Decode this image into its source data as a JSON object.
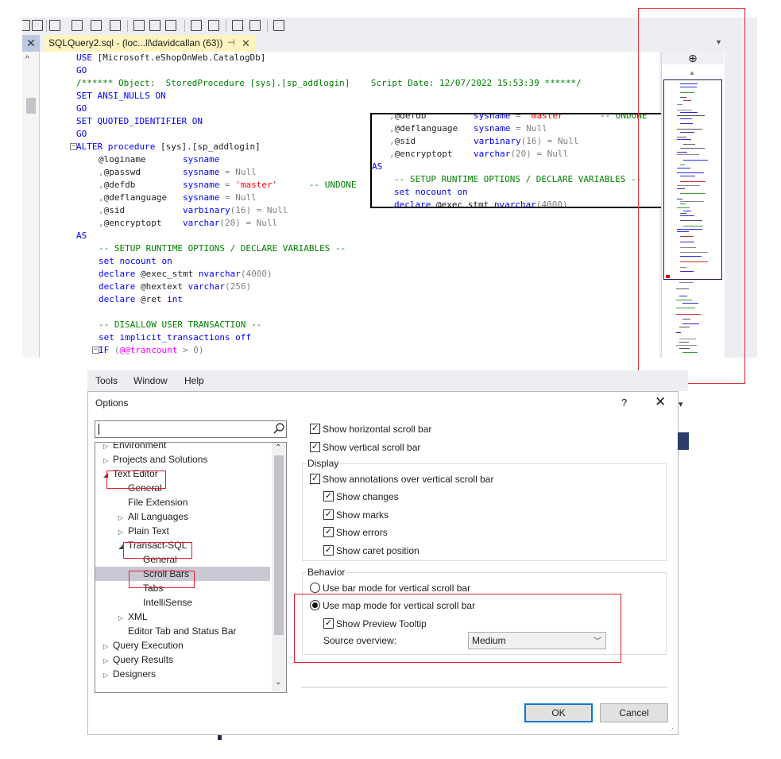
{
  "editor": {
    "tab_title": "SQLQuery2.sql - (loc...ll\\davidcallan (63))",
    "tab_pin": "⊣",
    "tab_close": "✕",
    "tab_dropdown": "▼",
    "left_close": "✕",
    "code_lines": [
      {
        "indent": 0,
        "parts": [
          [
            "kw",
            "USE "
          ],
          [
            "",
            "[Microsoft.eShopOnWeb.CatalogDb]"
          ]
        ]
      },
      {
        "indent": 0,
        "parts": [
          [
            "kw",
            "GO"
          ]
        ]
      },
      {
        "indent": 0,
        "parts": [
          [
            "cm",
            "/****** Object:  StoredProcedure [sys].[sp_addlogin]    Script Date: 12/07/2022 15:53:39 ******/"
          ]
        ]
      },
      {
        "indent": 0,
        "parts": [
          [
            "kw",
            "SET ANSI_NULLS ON"
          ]
        ]
      },
      {
        "indent": 0,
        "parts": [
          [
            "kw",
            "GO"
          ]
        ]
      },
      {
        "indent": 0,
        "parts": [
          [
            "kw",
            "SET QUOTED_IDENTIFIER ON"
          ]
        ]
      },
      {
        "indent": 0,
        "parts": [
          [
            "kw",
            "GO"
          ]
        ]
      },
      {
        "indent": 0,
        "fold": "−",
        "parts": [
          [
            "kw",
            "ALTER procedure "
          ],
          [
            "",
            "[sys].[sp_addlogin]"
          ]
        ]
      },
      {
        "indent": 1,
        "parts": [
          [
            "",
            "@loginame       "
          ],
          [
            "kw",
            "sysname"
          ]
        ]
      },
      {
        "indent": 1,
        "parts": [
          [
            "gy",
            ","
          ],
          [
            "",
            "@passwd        "
          ],
          [
            "kw",
            "sysname"
          ],
          [
            "gy",
            " = Null"
          ]
        ]
      },
      {
        "indent": 1,
        "parts": [
          [
            "gy",
            ","
          ],
          [
            "",
            "@defdb         "
          ],
          [
            "kw",
            "sysname"
          ],
          [
            "gy",
            " = "
          ],
          [
            "str",
            "'master'"
          ],
          [
            "cm",
            "      -- UNDONE"
          ]
        ]
      },
      {
        "indent": 1,
        "parts": [
          [
            "gy",
            ","
          ],
          [
            "",
            "@deflanguage   "
          ],
          [
            "kw",
            "sysname"
          ],
          [
            "gy",
            " = Null"
          ]
        ]
      },
      {
        "indent": 1,
        "parts": [
          [
            "gy",
            ","
          ],
          [
            "",
            "@sid           "
          ],
          [
            "kw",
            "varbinary"
          ],
          [
            "gy",
            "(16) = Null"
          ]
        ]
      },
      {
        "indent": 1,
        "parts": [
          [
            "gy",
            ","
          ],
          [
            "",
            "@encryptopt    "
          ],
          [
            "kw",
            "varchar"
          ],
          [
            "gy",
            "(20) = Null"
          ]
        ]
      },
      {
        "indent": 0,
        "parts": [
          [
            "kw",
            "AS"
          ]
        ]
      },
      {
        "indent": 1,
        "parts": [
          [
            "cm",
            "-- SETUP RUNTIME OPTIONS / DECLARE VARIABLES --"
          ]
        ]
      },
      {
        "indent": 1,
        "parts": [
          [
            "kw",
            "set nocount on"
          ]
        ]
      },
      {
        "indent": 1,
        "parts": [
          [
            "kw",
            "declare "
          ],
          [
            "",
            "@exec_stmt "
          ],
          [
            "kw",
            "nvarchar"
          ],
          [
            "gy",
            "(4000)"
          ]
        ]
      },
      {
        "indent": 1,
        "parts": [
          [
            "kw",
            "declare "
          ],
          [
            "",
            "@hextext "
          ],
          [
            "kw",
            "varchar"
          ],
          [
            "gy",
            "(256)"
          ]
        ]
      },
      {
        "indent": 1,
        "parts": [
          [
            "kw",
            "declare "
          ],
          [
            "",
            "@ret "
          ],
          [
            "kw",
            "int"
          ]
        ]
      },
      {
        "indent": 1,
        "parts": [
          [
            "",
            ""
          ]
        ]
      },
      {
        "indent": 1,
        "parts": [
          [
            "cm",
            "-- DISALLOW USER TRANSACTION --"
          ]
        ]
      },
      {
        "indent": 1,
        "parts": [
          [
            "kw",
            "set implicit_transactions off"
          ]
        ]
      },
      {
        "indent": 1,
        "fold": "−",
        "parts": [
          [
            "kw",
            "IF "
          ],
          [
            "gy",
            "("
          ],
          [
            "mg",
            "@@trancount"
          ],
          [
            "gy",
            " > 0)"
          ]
        ]
      }
    ],
    "zoom_lines": [
      {
        "x": 22,
        "parts": [
          [
            "gy",
            ","
          ],
          [
            "",
            "@defdb         "
          ],
          [
            "kw",
            "sysname"
          ],
          [
            "gy",
            " = "
          ],
          [
            "str",
            "'master'"
          ],
          [
            "cm",
            "      -- UNDONE"
          ]
        ]
      },
      {
        "x": 22,
        "parts": [
          [
            "gy",
            ","
          ],
          [
            "",
            "@deflanguage   "
          ],
          [
            "kw",
            "sysname"
          ],
          [
            "gy",
            " = Null"
          ]
        ]
      },
      {
        "x": 22,
        "parts": [
          [
            "gy",
            ","
          ],
          [
            "",
            "@sid           "
          ],
          [
            "kw",
            "varbinary"
          ],
          [
            "gy",
            "(16) = Null"
          ]
        ]
      },
      {
        "x": 22,
        "parts": [
          [
            "gy",
            ","
          ],
          [
            "",
            "@encryptopt    "
          ],
          [
            "kw",
            "varchar"
          ],
          [
            "gy",
            "(20) = Null"
          ]
        ]
      },
      {
        "x": 0,
        "parts": [
          [
            "kw",
            "AS"
          ]
        ]
      },
      {
        "x": 28,
        "parts": [
          [
            "cm",
            "-- SETUP RUNTIME OPTIONS / DECLARE VARIABLES --"
          ]
        ]
      },
      {
        "x": 28,
        "parts": [
          [
            "kw",
            "set nocount on"
          ]
        ]
      },
      {
        "x": 28,
        "parts": [
          [
            "kw",
            "declare "
          ],
          [
            "",
            "@exec_stmt "
          ],
          [
            "kw",
            "nvarchar"
          ],
          [
            "gy",
            "(4000)"
          ]
        ]
      }
    ],
    "split_icon": "⊕",
    "scroll_up_icon": "▲",
    "left_scroll_up_icon": "^"
  },
  "menubar": {
    "items": [
      "Tools",
      "Window",
      "Help"
    ]
  },
  "dialog": {
    "title": "Options",
    "help_label": "?",
    "close_label": "✕",
    "search_placeholder": "",
    "tree": [
      {
        "label": "Environment",
        "level": 0,
        "arrow": "▷"
      },
      {
        "label": "Projects and Solutions",
        "level": 0,
        "arrow": "▷"
      },
      {
        "label": "Text Editor",
        "level": 0,
        "arrow": "◢"
      },
      {
        "label": "General",
        "level": 1,
        "arrow": ""
      },
      {
        "label": "File Extension",
        "level": 1,
        "arrow": ""
      },
      {
        "label": "All Languages",
        "level": 1,
        "arrow": "▷"
      },
      {
        "label": "Plain Text",
        "level": 1,
        "arrow": "▷"
      },
      {
        "label": "Transact-SQL",
        "level": 1,
        "arrow": "◢"
      },
      {
        "label": "General",
        "level": 2,
        "arrow": ""
      },
      {
        "label": "Scroll Bars",
        "level": 2,
        "arrow": "",
        "selected": true
      },
      {
        "label": "Tabs",
        "level": 2,
        "arrow": ""
      },
      {
        "label": "IntelliSense",
        "level": 2,
        "arrow": ""
      },
      {
        "label": "XML",
        "level": 1,
        "arrow": "▷"
      },
      {
        "label": "Editor Tab and Status Bar",
        "level": 1,
        "arrow": ""
      },
      {
        "label": "Query Execution",
        "level": 0,
        "arrow": "▷"
      },
      {
        "label": "Query Results",
        "level": 0,
        "arrow": "▷"
      },
      {
        "label": "Designers",
        "level": 0,
        "arrow": "▷"
      }
    ],
    "show_horizontal": {
      "label": "Show horizontal scroll bar",
      "checked": true
    },
    "show_vertical": {
      "label": "Show vertical scroll bar",
      "checked": true
    },
    "display_label": "Display",
    "show_annotations": {
      "label": "Show annotations over vertical scroll bar",
      "checked": true
    },
    "show_changes": {
      "label": "Show changes",
      "checked": true
    },
    "show_marks": {
      "label": "Show marks",
      "checked": true
    },
    "show_errors": {
      "label": "Show errors",
      "checked": true
    },
    "show_caret": {
      "label": "Show caret position",
      "checked": true
    },
    "behavior_label": "Behavior",
    "bar_mode": {
      "label": "Use bar mode for vertical scroll bar",
      "selected": false
    },
    "map_mode": {
      "label": "Use map mode for vertical scroll bar",
      "selected": true
    },
    "preview_tooltip": {
      "label": "Show Preview Tooltip",
      "checked": true
    },
    "source_overview_label": "Source overview:",
    "source_overview_value": "Medium",
    "ok_label": "OK",
    "cancel_label": "Cancel"
  },
  "colors": {
    "keyword": "#0000ff",
    "string": "#ff0000",
    "comment": "#008000",
    "highlight": "#e0202a",
    "tab_active": "#fdf4bf",
    "focus": "#0078d7"
  }
}
